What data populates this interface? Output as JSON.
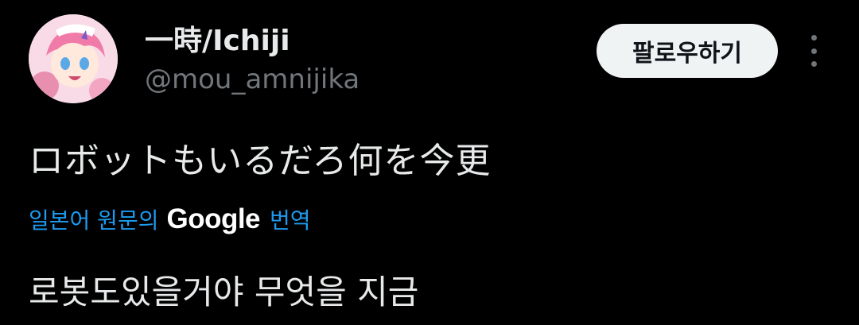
{
  "user": {
    "display_name": "一時/Ichiji",
    "handle": "@mou_amnijika"
  },
  "actions": {
    "follow_label": "팔로우하기",
    "more_icon": "more-vertical-icon"
  },
  "tweet": {
    "text": "ロボットもいるだろ何を今更"
  },
  "translation": {
    "source_label": "일본어 원문의",
    "provider": "Google",
    "link_label": "번역",
    "translated_text": "로봇도있을거야 무엇을 지금"
  },
  "colors": {
    "background": "#000000",
    "text": "#e7e9ea",
    "secondary": "#71767b",
    "accent": "#1d9bf0",
    "button_bg": "#eff3f4"
  }
}
